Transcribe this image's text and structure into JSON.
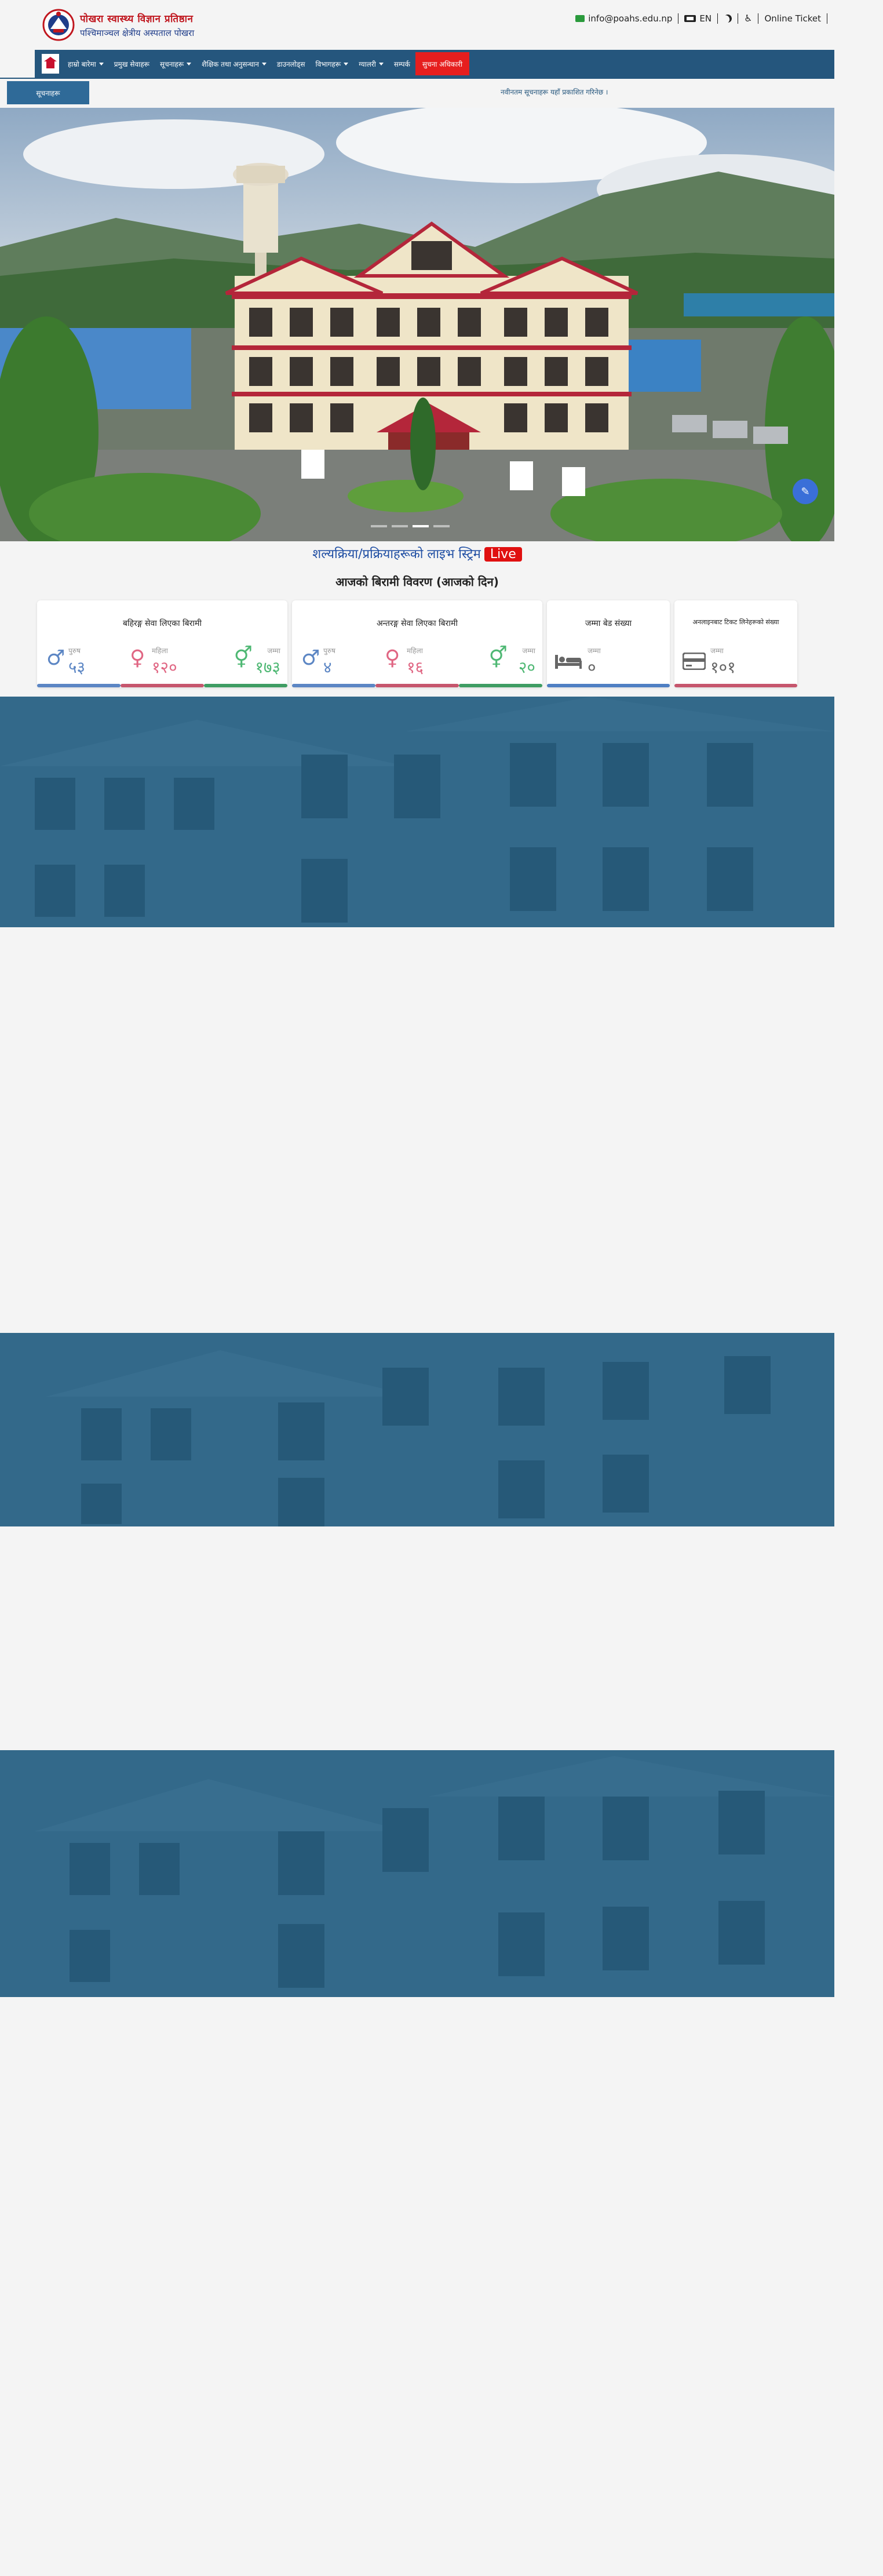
{
  "header": {
    "logo_line1": "पोखरा स्वास्थ्य विज्ञान प्रतिष्ठान",
    "logo_line2": "पश्चिमाञ्चल क्षेत्रीय अस्पताल पोखरा",
    "email": "info@poahs.edu.np",
    "lang_label": "EN",
    "online_ticket": "Online Ticket"
  },
  "nav": {
    "items": [
      {
        "label": "हाम्रो बारेमा",
        "dropdown": true
      },
      {
        "label": "प्रमुख सेवाहरू",
        "dropdown": false
      },
      {
        "label": "सूचनाहरू",
        "dropdown": true
      },
      {
        "label": "शैक्षिक तथा अनुसन्धान",
        "dropdown": true
      },
      {
        "label": "डाउनलोड्स",
        "dropdown": false
      },
      {
        "label": "विभागहरू",
        "dropdown": true
      },
      {
        "label": "ग्यालरी",
        "dropdown": true
      },
      {
        "label": "सम्पर्क",
        "dropdown": false
      }
    ],
    "highlight": "सुचना अधिकारी"
  },
  "notice": {
    "button": "सूचनाहरू",
    "ticker": "नवीनतम सूचनाहरू यहाँ प्रकाशित गरिनेछ ।"
  },
  "live": {
    "text": "शल्यक्रिया/प्रक्रियाहरूको लाइभ स्ट्रिम",
    "badge": "Live"
  },
  "stats": {
    "title": "आजको बिरामी विवरण (आजको दिन)",
    "opd": {
      "title": "बहिरङ्ग सेवा लिएका बिरामी",
      "male_label": "पुरुष",
      "male": "५३",
      "female_label": "महिला",
      "female": "१२०",
      "total_label": "जम्मा",
      "total": "१७३"
    },
    "ipd": {
      "title": "अन्तरङ्ग सेवा लिएका बिरामी",
      "male_label": "पुरुष",
      "male": "४",
      "female_label": "महिला",
      "female": "१६",
      "total_label": "जम्मा",
      "total": "२०"
    },
    "beds": {
      "title": "जम्मा बेड संख्या",
      "label": "जम्मा",
      "value": "०"
    },
    "tickets": {
      "title": "अनलाइनबाट टिकट लिनेहरूको संख्या",
      "label": "जम्मा",
      "value": "१०१"
    }
  },
  "colors": {
    "nav": "#25567d",
    "male": "#5c86c4",
    "female": "#e06683",
    "total": "#4fb874",
    "overlay": "#1d5f86",
    "live": "#e01010"
  },
  "icons": [
    "home-icon",
    "envelope-icon",
    "language-icon",
    "moon-icon",
    "accessibility-icon",
    "male-icon",
    "female-icon",
    "gender-icon",
    "bed-icon",
    "ticket-card-icon",
    "chat-icon"
  ]
}
